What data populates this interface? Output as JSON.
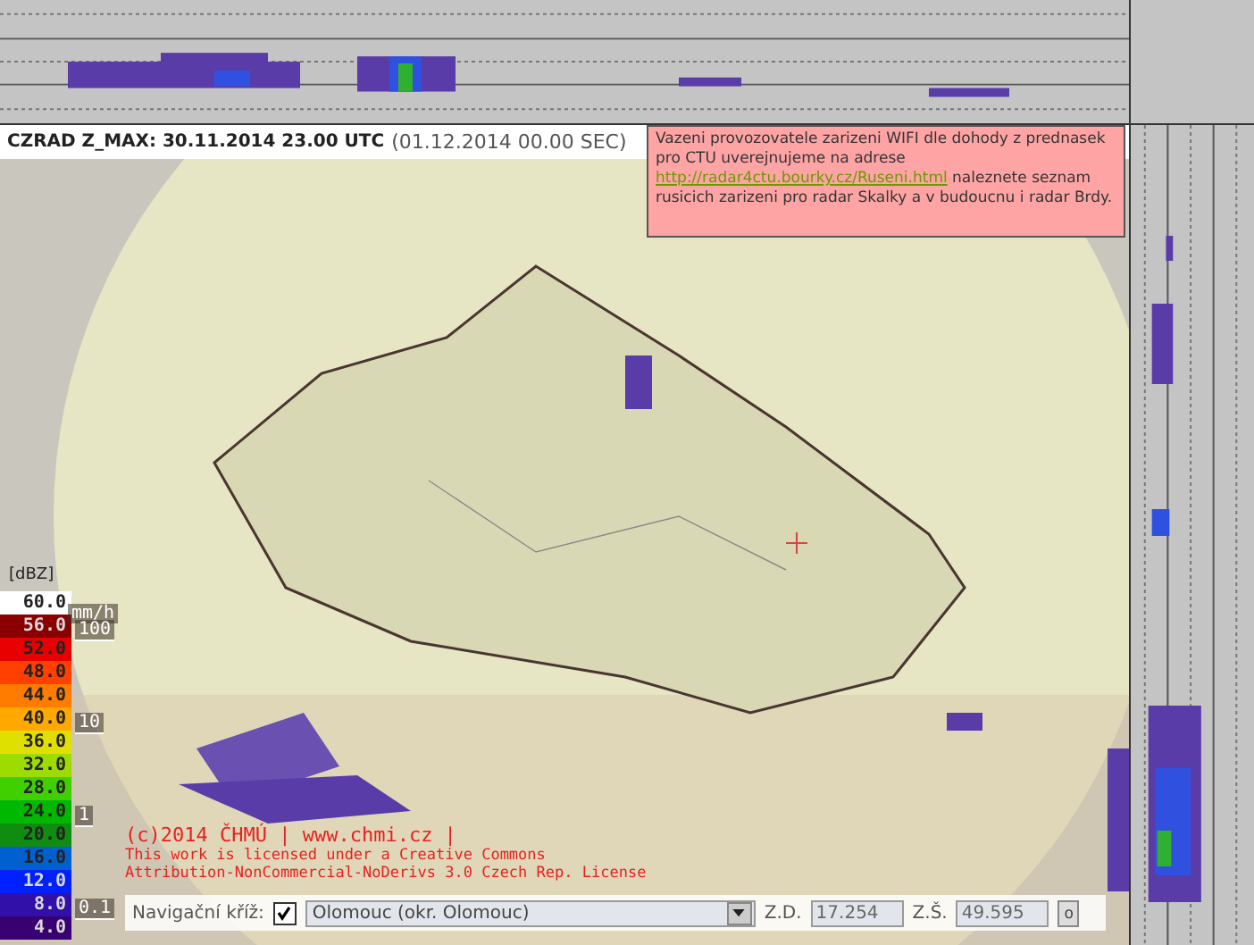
{
  "header": {
    "title": "CZRAD Z_MAX: 30.11.2014 23.00 UTC",
    "local_time": "(01.12.2014 00.00 SEC)"
  },
  "notice": {
    "text_before": "Vazeni provozovatele zarizeni WIFI dle dohody z prednasek pro CTU uverejnujeme na adrese",
    "link": "http://radar4ctu.bourky.cz/Ruseni.html",
    "text_after": "naleznete seznam rusicich zarizeni pro radar Skalky a v budoucnu i radar Brdy."
  },
  "legend": {
    "unit": "[dBZ]",
    "rate_unit": "mm/h",
    "items": [
      {
        "label": "60.0",
        "color": "#ffffff"
      },
      {
        "label": "56.0",
        "color": "#8a0000"
      },
      {
        "label": "52.0",
        "color": "#e80000"
      },
      {
        "label": "48.0",
        "color": "#ff4000"
      },
      {
        "label": "44.0",
        "color": "#ff7c00"
      },
      {
        "label": "40.0",
        "color": "#ffa800"
      },
      {
        "label": "36.0",
        "color": "#e0e000"
      },
      {
        "label": "32.0",
        "color": "#9cdc00"
      },
      {
        "label": "28.0",
        "color": "#40d000"
      },
      {
        "label": "24.0",
        "color": "#00b800"
      },
      {
        "label": "20.0",
        "color": "#108c10"
      },
      {
        "label": "16.0",
        "color": "#0060d0"
      },
      {
        "label": "12.0",
        "color": "#0020ff"
      },
      {
        "label": "8.0",
        "color": "#3010a8"
      },
      {
        "label": "4.0",
        "color": "#380070"
      }
    ],
    "rates": [
      "100",
      "10",
      "1",
      "0.1"
    ]
  },
  "copyright": {
    "line": "(c)2014 ČHMÚ | www.chmi.cz |",
    "license": "This work is licensed under a Creative Commons Attribution-NonCommercial-NoDerivs 3.0 Czech Rep. License"
  },
  "controls": {
    "nav_label": "Navigační kříž:",
    "nav_checked": true,
    "location": "Olomouc (okr. Olomouc)",
    "lon_label": "Z.D.",
    "lon": "17.254",
    "lat_label": "Z.Š.",
    "lat": "49.595",
    "go": "o"
  }
}
